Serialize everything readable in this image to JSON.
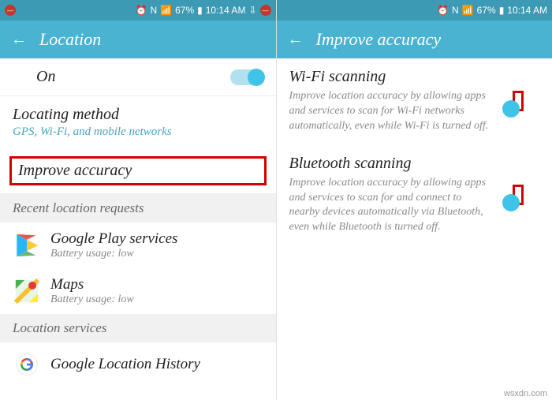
{
  "status": {
    "signal": "📶",
    "battery": "67%",
    "time": "10:14 AM",
    "alarm": "⏰",
    "nfc": "N",
    "dropbox": "⇩"
  },
  "left": {
    "title": "Location",
    "on_label": "On",
    "locating_method": {
      "title": "Locating method",
      "subtitle": "GPS, Wi-Fi, and mobile networks"
    },
    "improve_accuracy": "Improve accuracy",
    "recent_header": "Recent location requests",
    "play": {
      "title": "Google Play services",
      "sub": "Battery usage: low"
    },
    "maps": {
      "title": "Maps",
      "sub": "Battery usage: low"
    },
    "services_header": "Location services",
    "history": {
      "title": "Google Location History"
    }
  },
  "right": {
    "title": "Improve accuracy",
    "wifi": {
      "title": "Wi-Fi scanning",
      "desc": "Improve location accuracy by allowing apps and services to scan for Wi-Fi networks automatically, even while Wi-Fi is turned off."
    },
    "bt": {
      "title": "Bluetooth scanning",
      "desc": "Improve location accuracy by allowing apps and services to scan for and connect to nearby devices automatically via Bluetooth, even while Bluetooth is turned off."
    }
  },
  "watermark": "wsxdn.com"
}
